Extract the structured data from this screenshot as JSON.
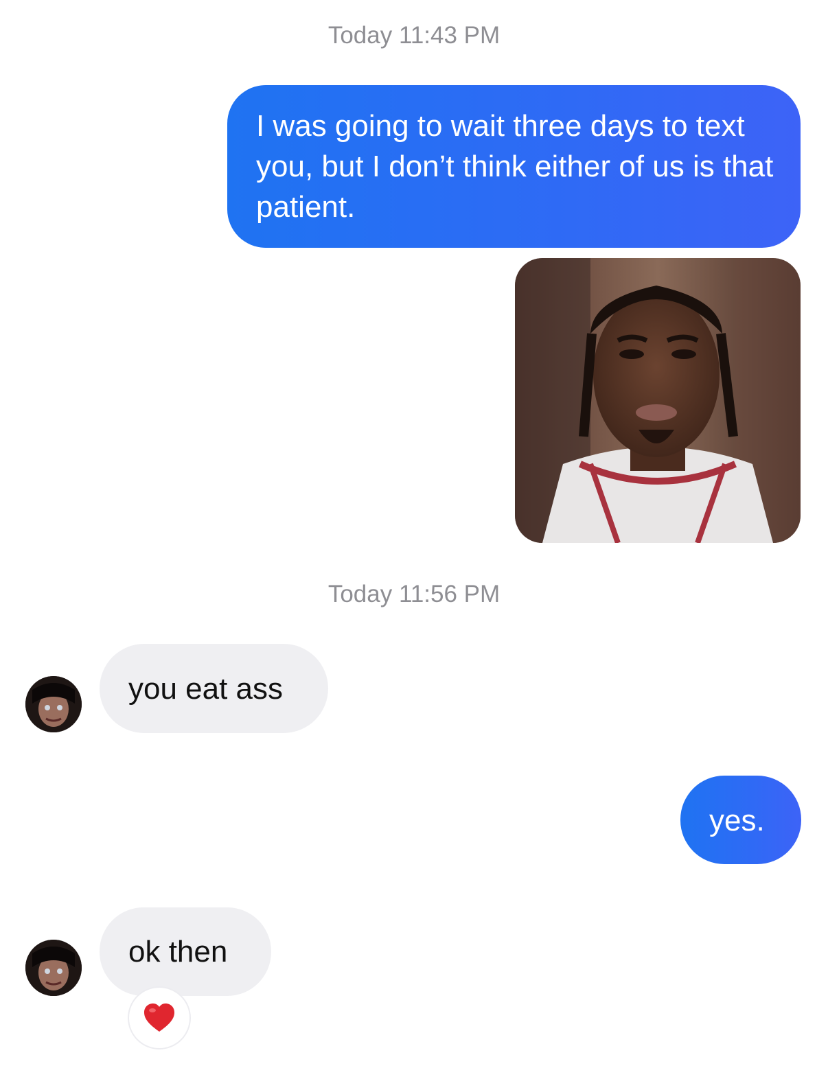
{
  "conversation": {
    "timestamps": [
      "Today 11:43 PM",
      "Today 11:56 PM"
    ],
    "messages": [
      {
        "direction": "outgoing",
        "type": "text",
        "text": "I was going to wait three days to text you, but I don’t think either of us is that patient."
      },
      {
        "direction": "outgoing",
        "type": "photo"
      },
      {
        "direction": "incoming",
        "type": "text",
        "text": "you eat ass"
      },
      {
        "direction": "outgoing",
        "type": "text",
        "text": "yes."
      },
      {
        "direction": "incoming",
        "type": "text",
        "text": "ok then",
        "reaction": "❤️"
      }
    ]
  },
  "colors": {
    "outgoing_bubble": "#2f6af5",
    "incoming_bubble": "#efeff2",
    "timestamp_text": "#8e8e93",
    "reaction_heart": "#e0262f"
  },
  "icons": {
    "reaction": "heart-icon",
    "avatar": "user-avatar"
  }
}
